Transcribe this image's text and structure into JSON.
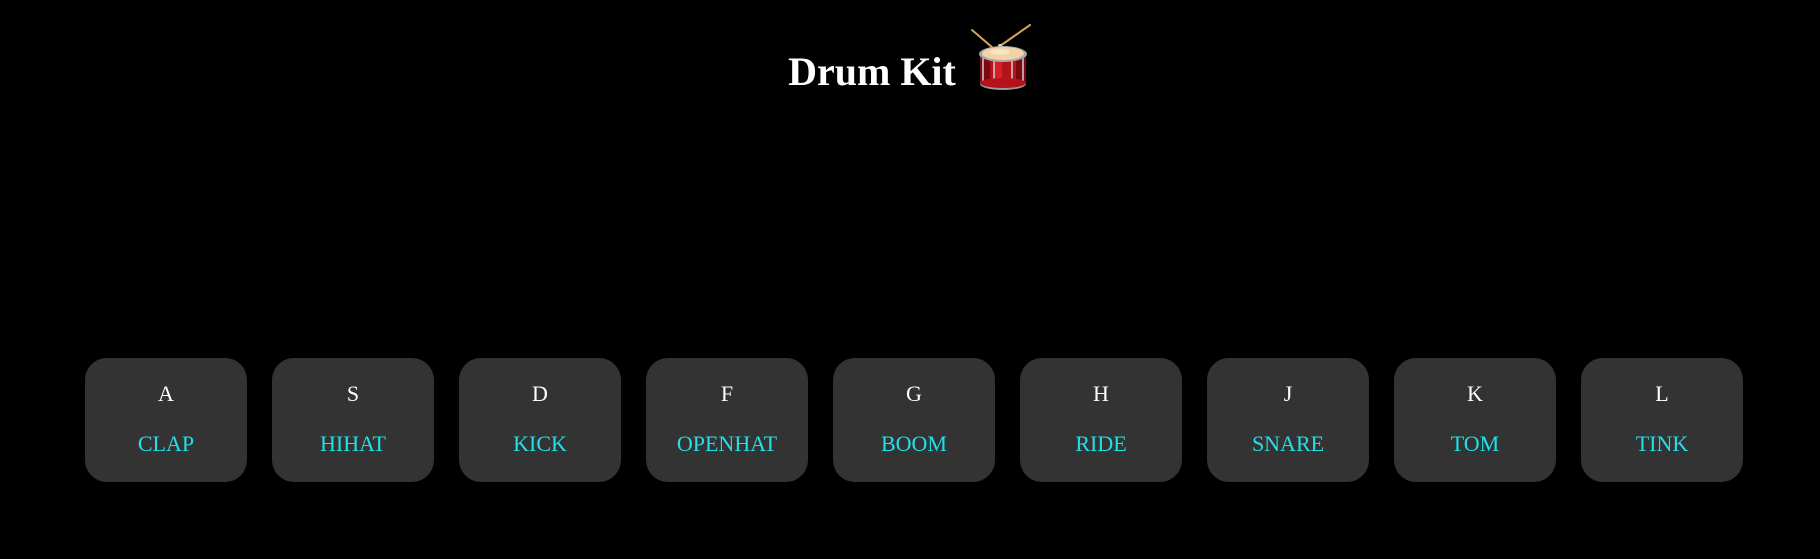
{
  "header": {
    "title": "Drum Kit",
    "icon": "drum-icon"
  },
  "colors": {
    "background": "#000000",
    "key_background": "#333333",
    "letter": "#ffffff",
    "sound_label": "#22e0e8"
  },
  "keys": [
    {
      "letter": "A",
      "sound": "CLAP"
    },
    {
      "letter": "S",
      "sound": "HIHAT"
    },
    {
      "letter": "D",
      "sound": "KICK"
    },
    {
      "letter": "F",
      "sound": "OPENHAT"
    },
    {
      "letter": "G",
      "sound": "BOOM"
    },
    {
      "letter": "H",
      "sound": "RIDE"
    },
    {
      "letter": "J",
      "sound": "SNARE"
    },
    {
      "letter": "K",
      "sound": "TOM"
    },
    {
      "letter": "L",
      "sound": "TINK"
    }
  ]
}
